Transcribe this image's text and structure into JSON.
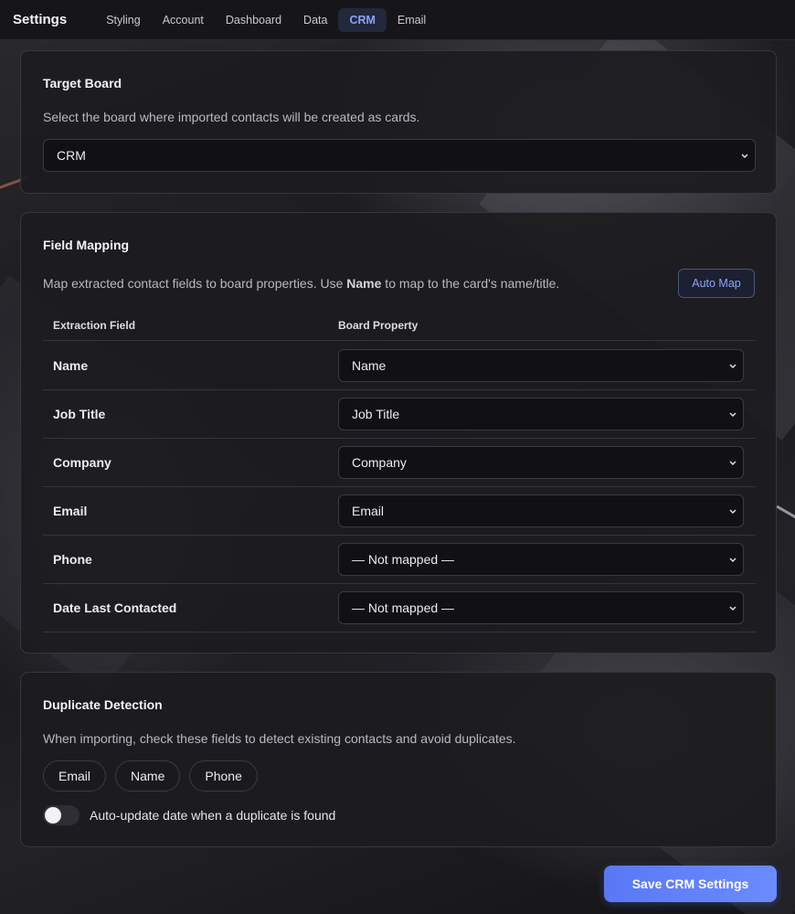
{
  "app": {
    "title": "Settings"
  },
  "nav": {
    "tabs": [
      {
        "label": "Styling"
      },
      {
        "label": "Account"
      },
      {
        "label": "Dashboard"
      },
      {
        "label": "Data"
      },
      {
        "label": "CRM"
      },
      {
        "label": "Email"
      }
    ],
    "active": "CRM"
  },
  "target_board": {
    "title": "Target Board",
    "description": "Select the board where imported contacts will be created as cards.",
    "selected": "CRM"
  },
  "field_mapping": {
    "title": "Field Mapping",
    "description_pre": "Map extracted contact fields to board properties. Use ",
    "description_bold": "Name",
    "description_post": " to map to the card's name/title.",
    "auto_map_label": "Auto Map",
    "headers": {
      "extraction": "Extraction Field",
      "property": "Board Property"
    },
    "rows": [
      {
        "field": "Name",
        "property": "Name"
      },
      {
        "field": "Job Title",
        "property": "Job Title"
      },
      {
        "field": "Company",
        "property": "Company"
      },
      {
        "field": "Email",
        "property": "Email"
      },
      {
        "field": "Phone",
        "property": "— Not mapped —"
      },
      {
        "field": "Date Last Contacted",
        "property": "— Not mapped —"
      }
    ]
  },
  "duplicate_detection": {
    "title": "Duplicate Detection",
    "description": "When importing, check these fields to detect existing contacts and avoid duplicates.",
    "fields": [
      "Email",
      "Name",
      "Phone"
    ],
    "toggle_label": "Auto-update date when a duplicate is found",
    "toggle_on": false
  },
  "save_label": "Save CRM Settings",
  "colors": {
    "accent": "#6b8bff",
    "active_tab_text": "#8aa2ff",
    "panel": "#1c1c20"
  }
}
